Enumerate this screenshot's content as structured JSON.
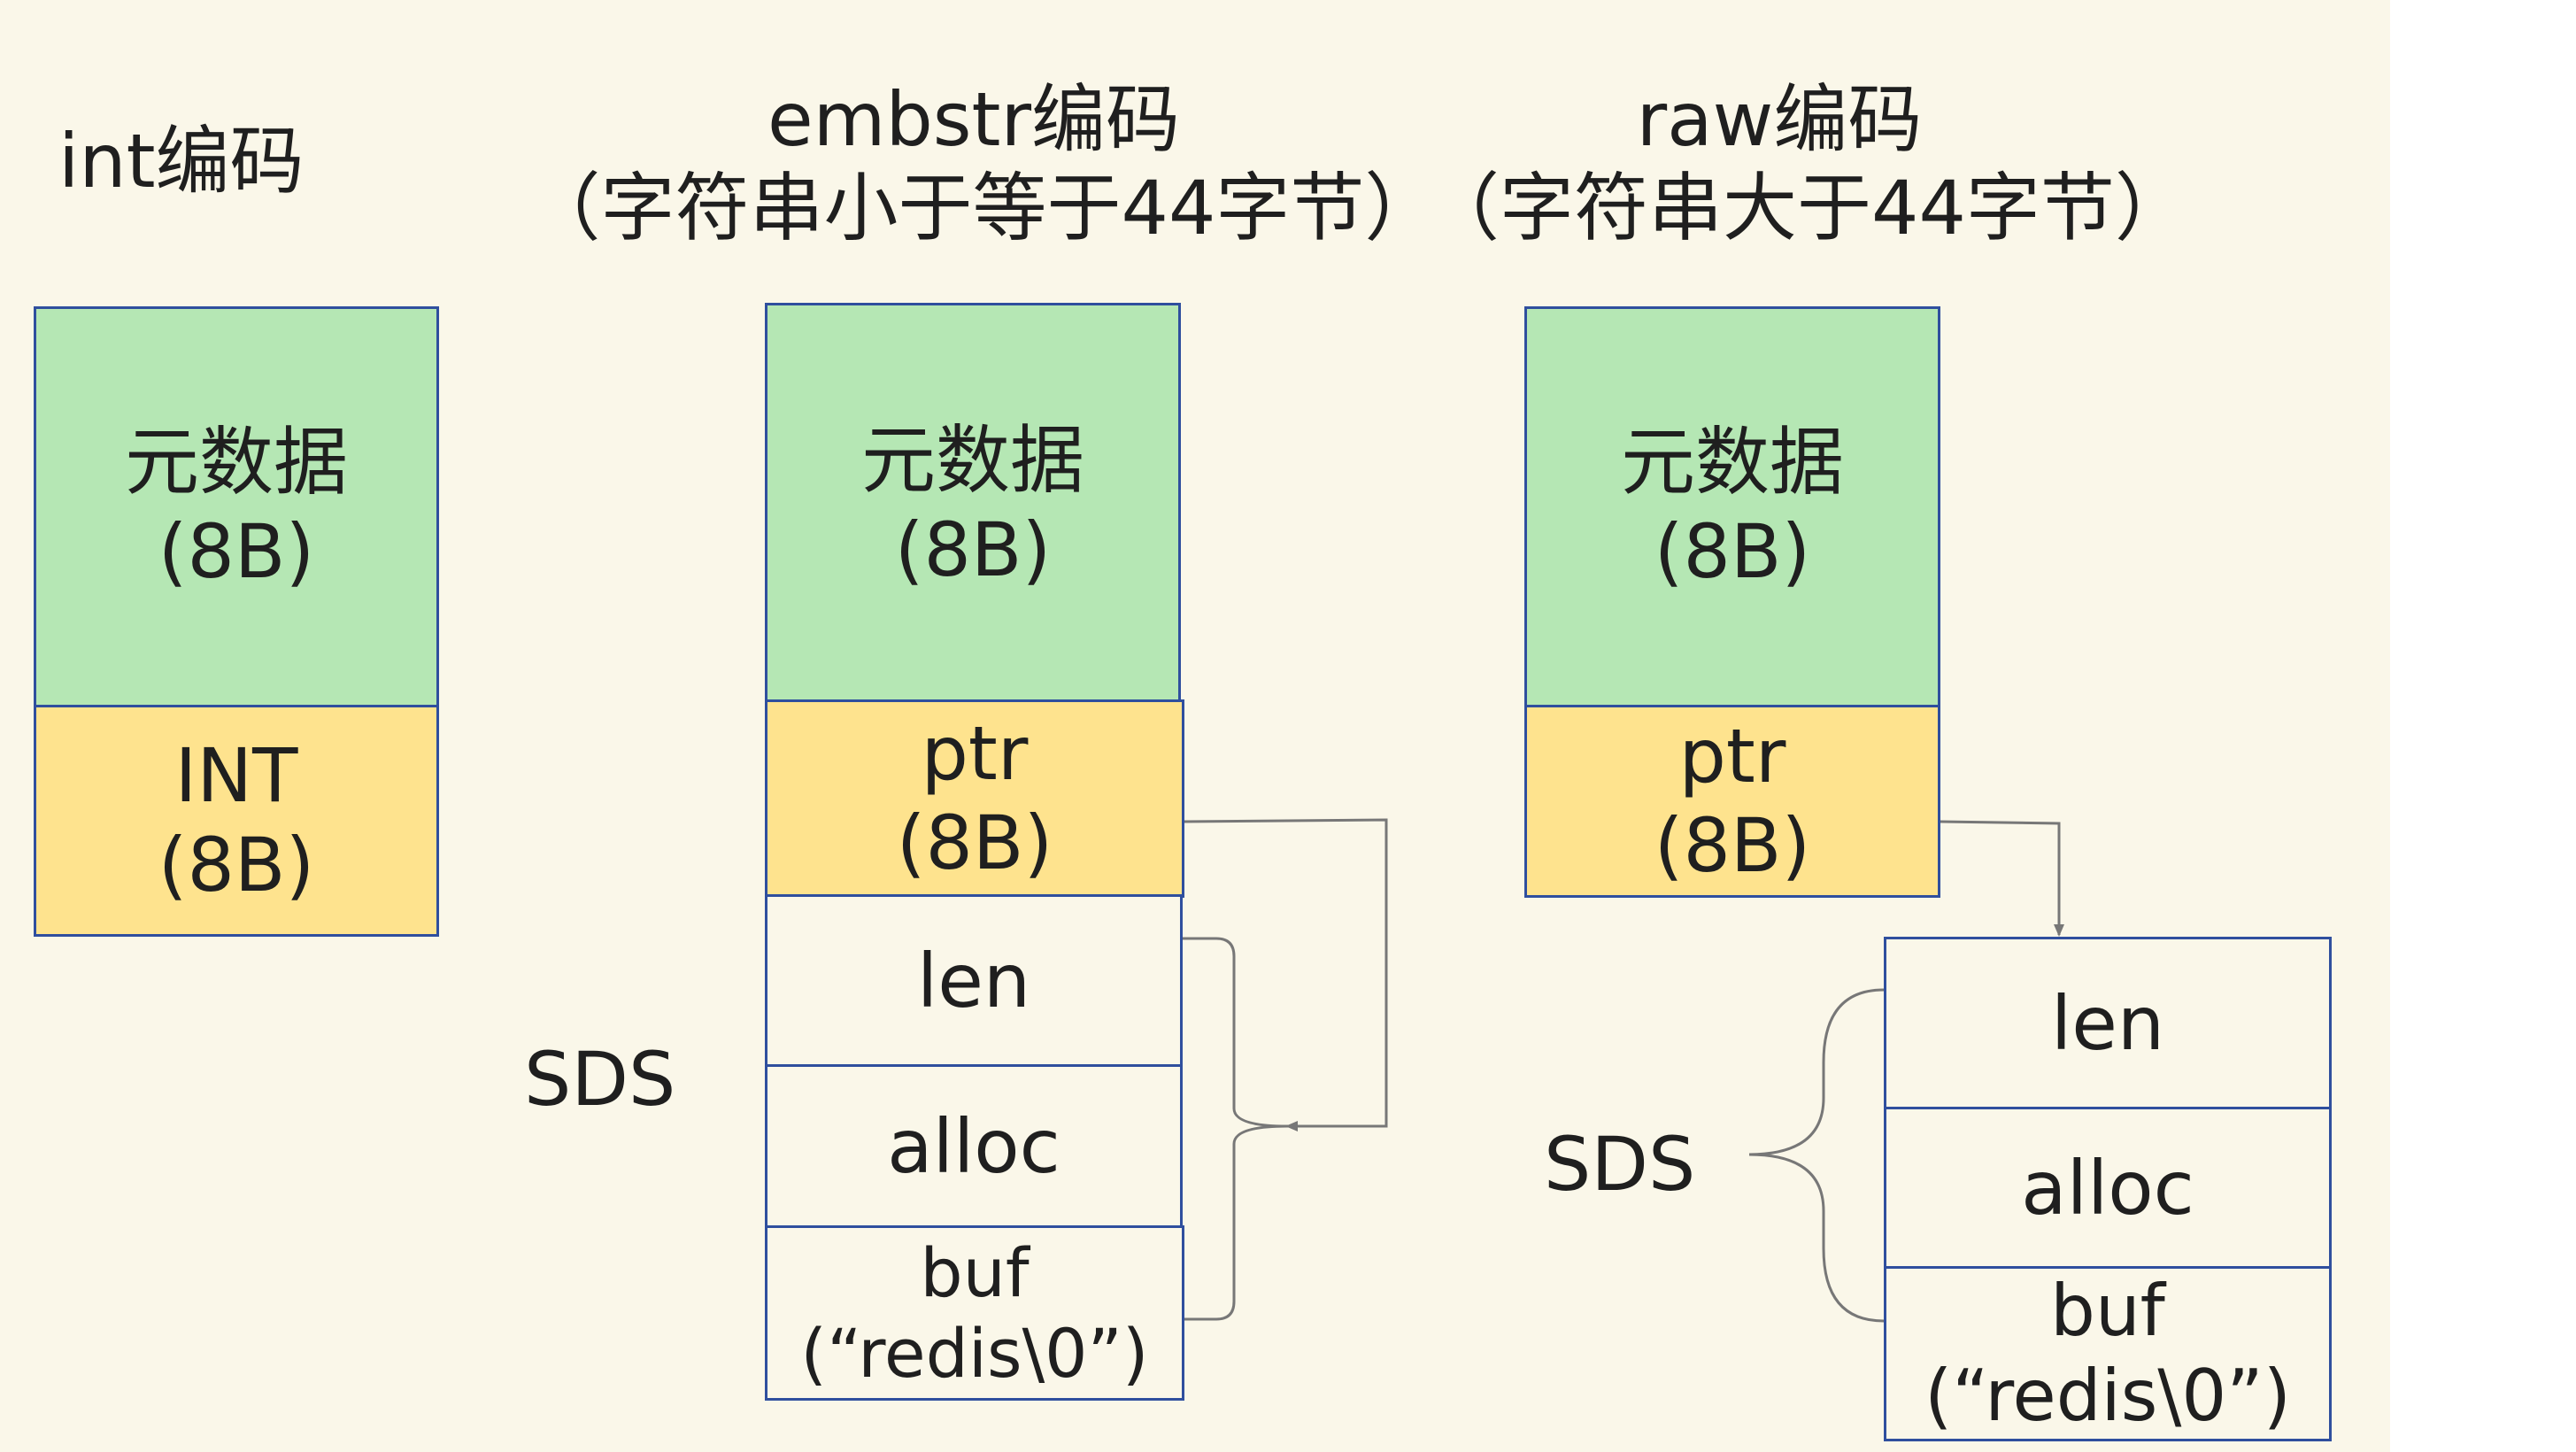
{
  "titles": {
    "int_encoding": "int编码",
    "embstr_encoding": "embstr编码",
    "embstr_note": "（字符串小于等于44字节）",
    "raw_encoding": "raw编码",
    "raw_note": "（字符串大于44字节）"
  },
  "int_column": {
    "metadata": {
      "line1": "元数据",
      "line2": "(8B)"
    },
    "value": {
      "line1": "INT",
      "line2": "(8B)"
    }
  },
  "embstr_column": {
    "metadata": {
      "line1": "元数据",
      "line2": "(8B)"
    },
    "ptr": {
      "line1": "ptr",
      "line2": "(8B)"
    },
    "len": "len",
    "alloc": "alloc",
    "buf": {
      "line1": "buf",
      "line2": "(“redis\\0”)"
    },
    "sds_label": "SDS"
  },
  "raw_column": {
    "metadata": {
      "line1": "元数据",
      "line2": "(8B)"
    },
    "ptr": {
      "line1": "ptr",
      "line2": "(8B)"
    },
    "len": "len",
    "alloc": "alloc",
    "buf": {
      "line1": "buf",
      "line2": "(“redis\\0”)"
    },
    "sds_label": "SDS"
  },
  "colors": {
    "background": "#faf7e9",
    "metadata_fill": "#b5e7b4",
    "field_fill": "#fee38e",
    "border": "#2f4f9e",
    "connector": "#777777"
  }
}
